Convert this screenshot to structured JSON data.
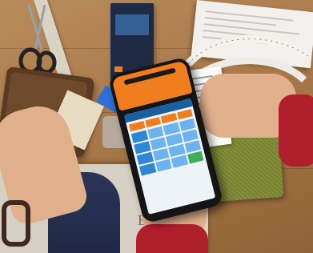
{
  "scene": {
    "colors": {
      "terminal_accent": "#f07d1e",
      "terminal_body": "#151515",
      "wood": "#a9794a",
      "fabric": "#7d8a33",
      "sleeve": "#b01f2c"
    },
    "magazine_text": "EN"
  }
}
